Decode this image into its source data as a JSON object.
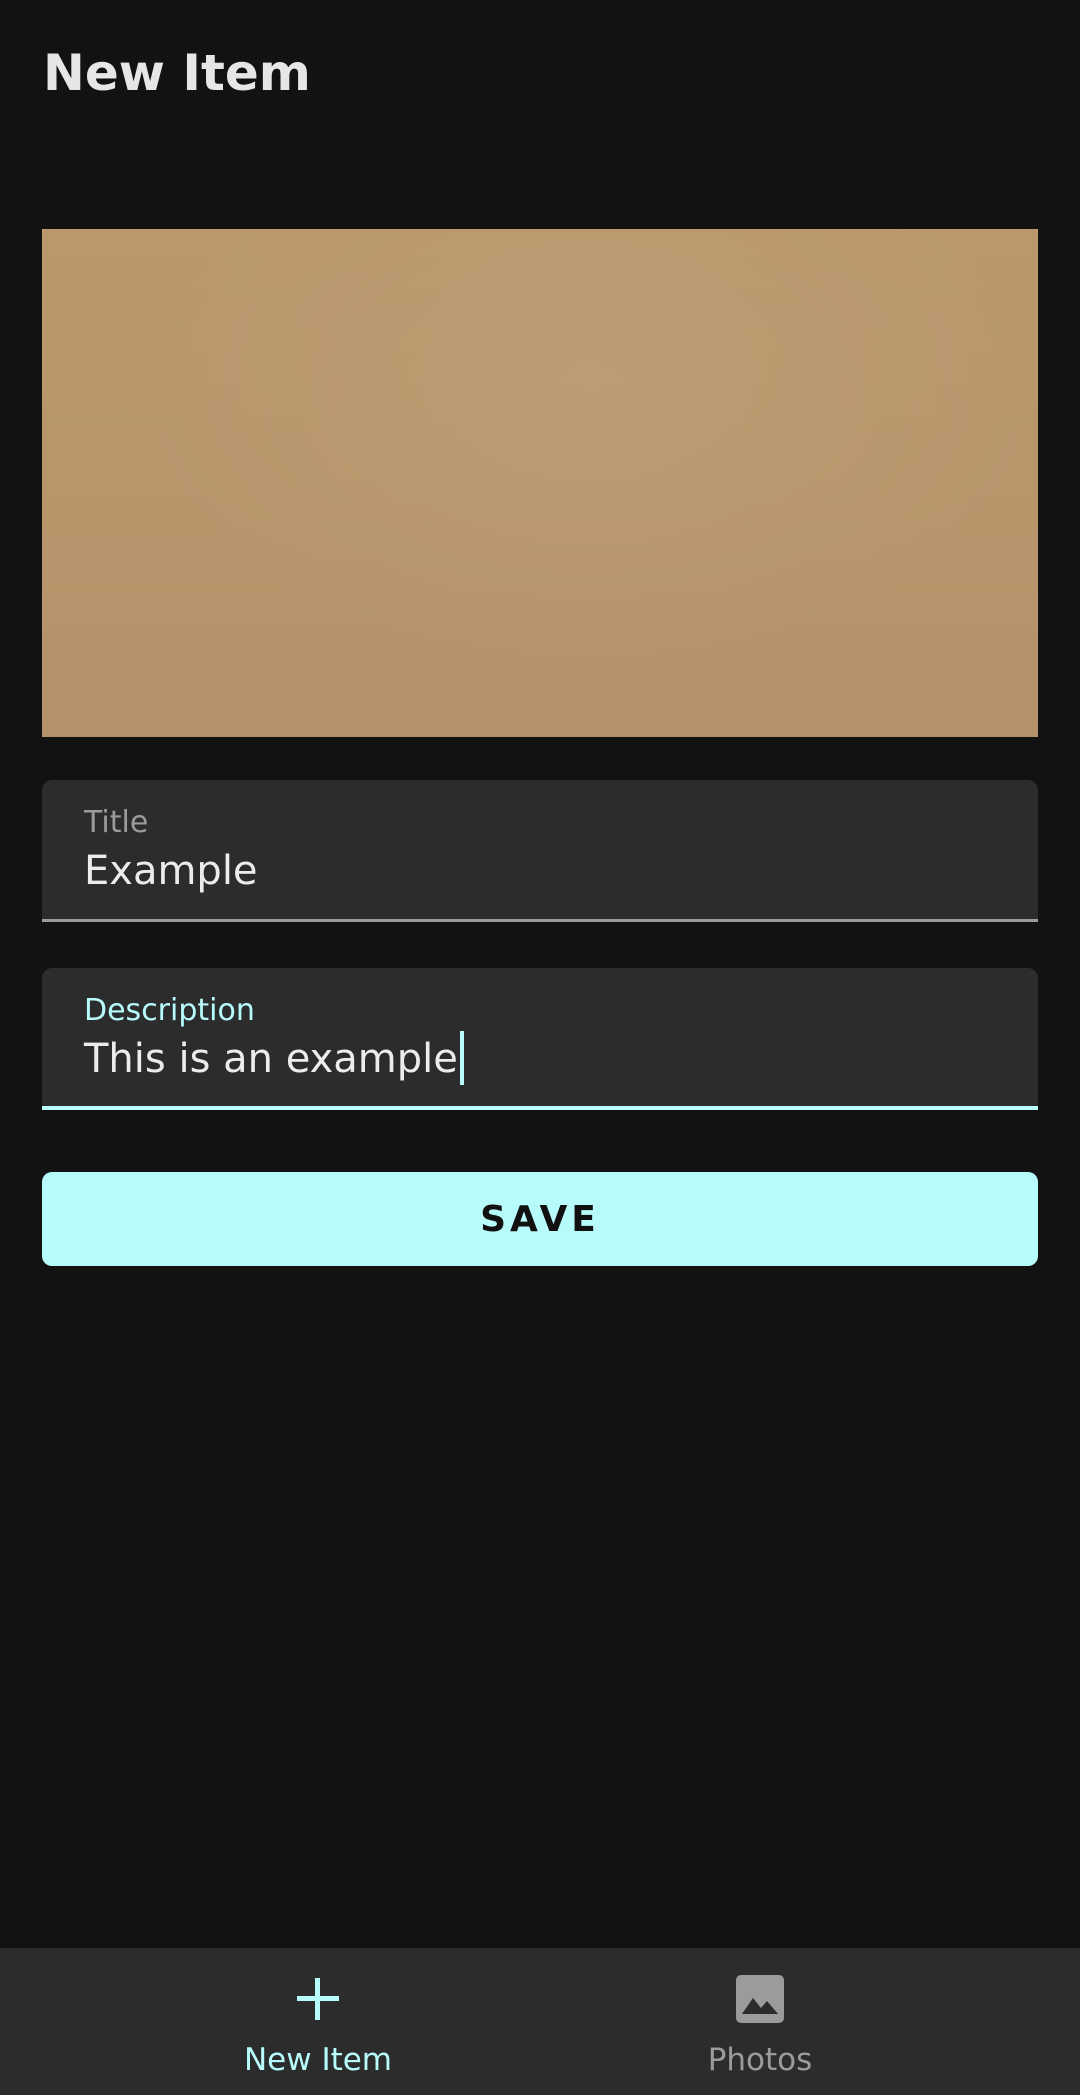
{
  "header": {
    "title": "New Item"
  },
  "photo": {
    "color": "#b8946b"
  },
  "form": {
    "title_field": {
      "label": "Title",
      "value": "Example"
    },
    "description_field": {
      "label": "Description",
      "value": "This is an example"
    },
    "save_label": "SAVE"
  },
  "bottom_nav": {
    "items": [
      {
        "label": "New Item",
        "icon": "plus-icon",
        "active": true
      },
      {
        "label": "Photos",
        "icon": "image-icon",
        "active": false
      }
    ]
  },
  "colors": {
    "background": "#121212",
    "surface": "#2c2c2c",
    "accent": "#b7fbfb",
    "muted_text": "#9b9b9b"
  }
}
